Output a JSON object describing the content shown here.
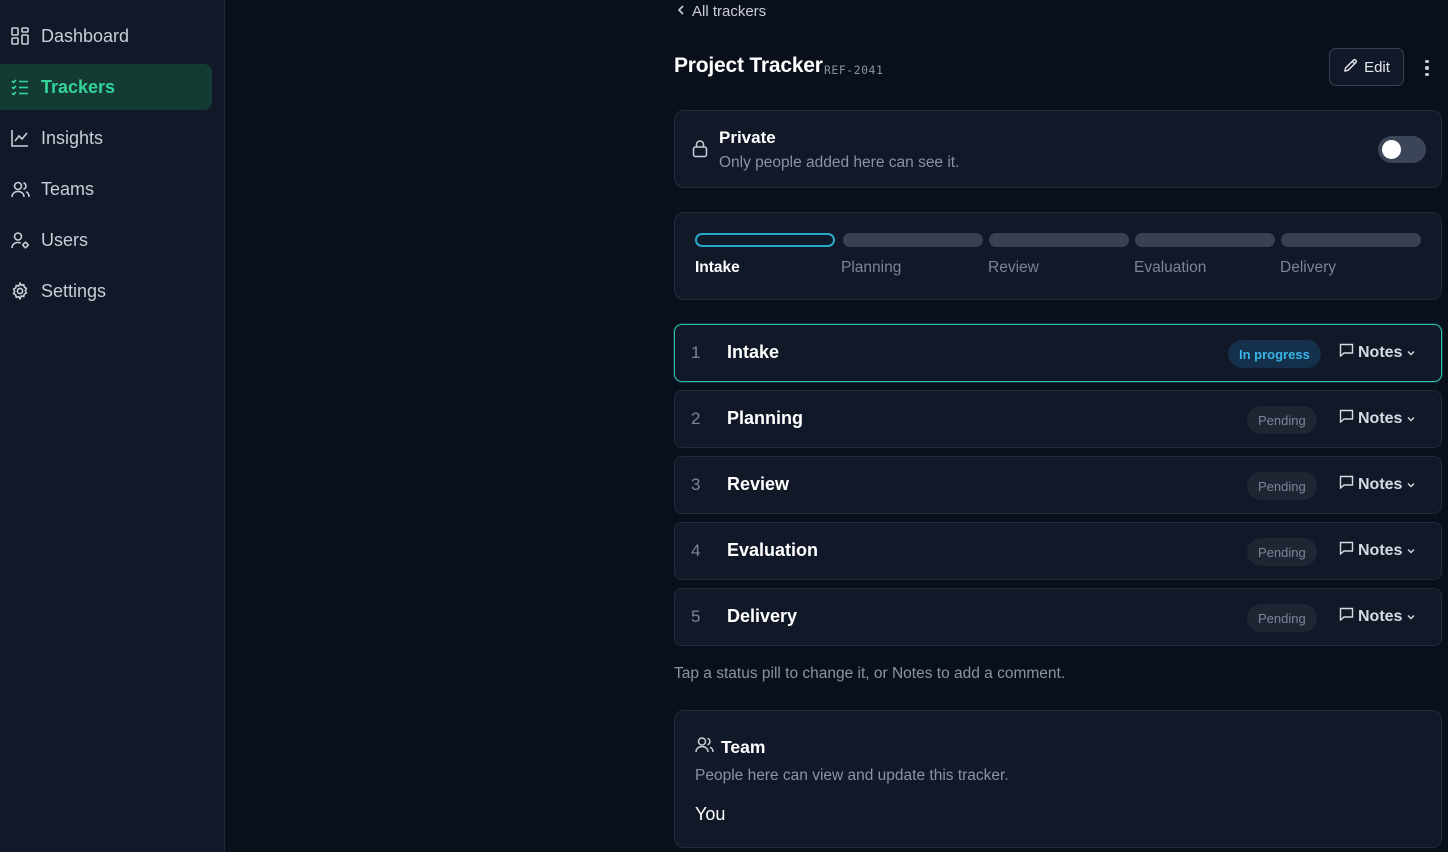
{
  "sidebar": {
    "items": [
      {
        "label": "Dashboard",
        "icon": "grid-icon"
      },
      {
        "label": "Trackers",
        "icon": "list-check-icon",
        "active": true
      },
      {
        "label": "Insights",
        "icon": "chart-line-icon"
      },
      {
        "label": "Teams",
        "icon": "users-icon"
      },
      {
        "label": "Users",
        "icon": "user-cog-icon"
      },
      {
        "label": "Settings",
        "icon": "gear-icon"
      }
    ]
  },
  "header": {
    "back_label": "All trackers",
    "title": "Project Tracker",
    "ref": "REF-2041",
    "edit_label": "Edit"
  },
  "privacy": {
    "title": "Private",
    "subtitle": "Only people added here can see it.",
    "enabled": false
  },
  "progress": {
    "stages": [
      "Intake",
      "Planning",
      "Review",
      "Evaluation",
      "Delivery"
    ],
    "current_index": 0
  },
  "stages": [
    {
      "num": "1",
      "name": "Intake",
      "status": "In progress",
      "notes_label": "Notes"
    },
    {
      "num": "2",
      "name": "Planning",
      "status": "Pending",
      "notes_label": "Notes"
    },
    {
      "num": "3",
      "name": "Review",
      "status": "Pending",
      "notes_label": "Notes"
    },
    {
      "num": "4",
      "name": "Evaluation",
      "status": "Pending",
      "notes_label": "Notes"
    },
    {
      "num": "5",
      "name": "Delivery",
      "status": "Pending",
      "notes_label": "Notes"
    }
  ],
  "hint": "Tap a status pill to change it, or Notes to add a comment.",
  "team": {
    "title": "Team",
    "subtitle": "People here can view and update this tracker.",
    "members": [
      "You"
    ]
  },
  "colors": {
    "accent": "#34d399",
    "active_border": "#2dbfa7",
    "progress_pill": "#38b6e8",
    "background": "#0a0f1c",
    "card": "#111827"
  }
}
